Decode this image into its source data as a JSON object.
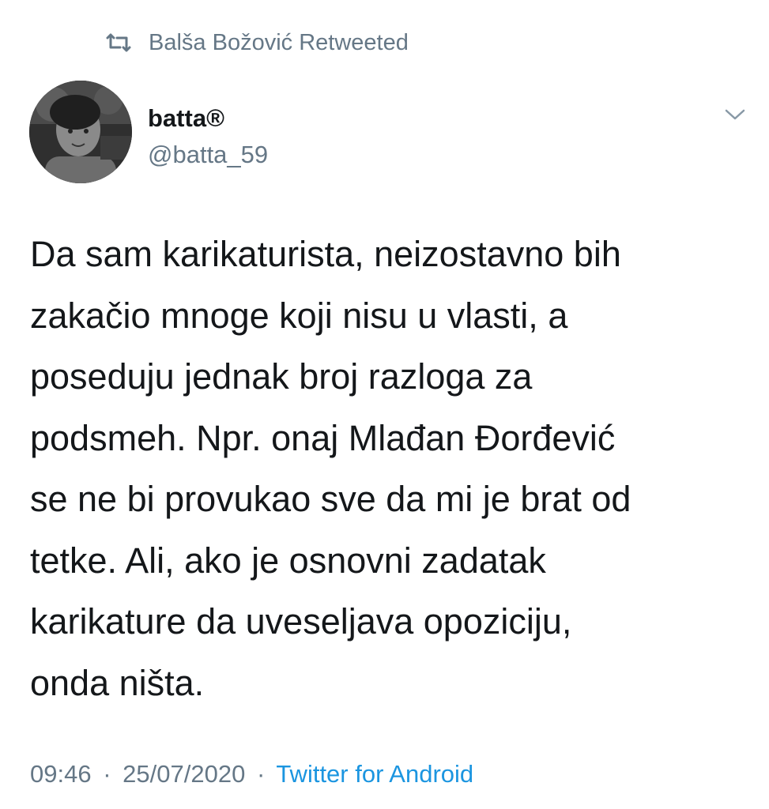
{
  "retweet": {
    "icon": "retweet-icon",
    "label": "Balša Božović Retweeted"
  },
  "author": {
    "name": "batta®",
    "handle": "@batta_59",
    "avatar": "avatar-photo"
  },
  "menu_icon": "chevron-down-icon",
  "tweet": {
    "lines": [
      "Da sam karikaturista, neizostavno bih",
      "zakačio mnoge koji nisu u vlasti, a",
      "poseduju jednak broj razloga za",
      "podsmeh. Npr. onaj Mlađan Đorđević",
      "se ne bi provukao sve da mi je brat od",
      "tetke. Ali, ako je osnovni zadatak",
      "karikature da uveseljava opoziciju,",
      "onda ništa."
    ]
  },
  "meta": {
    "time": "09:46",
    "date": "25/07/2020",
    "separator": "·",
    "source": "Twitter for Android"
  },
  "colors": {
    "text": "#14171a",
    "secondary": "#657786",
    "link": "#1b95e0"
  }
}
